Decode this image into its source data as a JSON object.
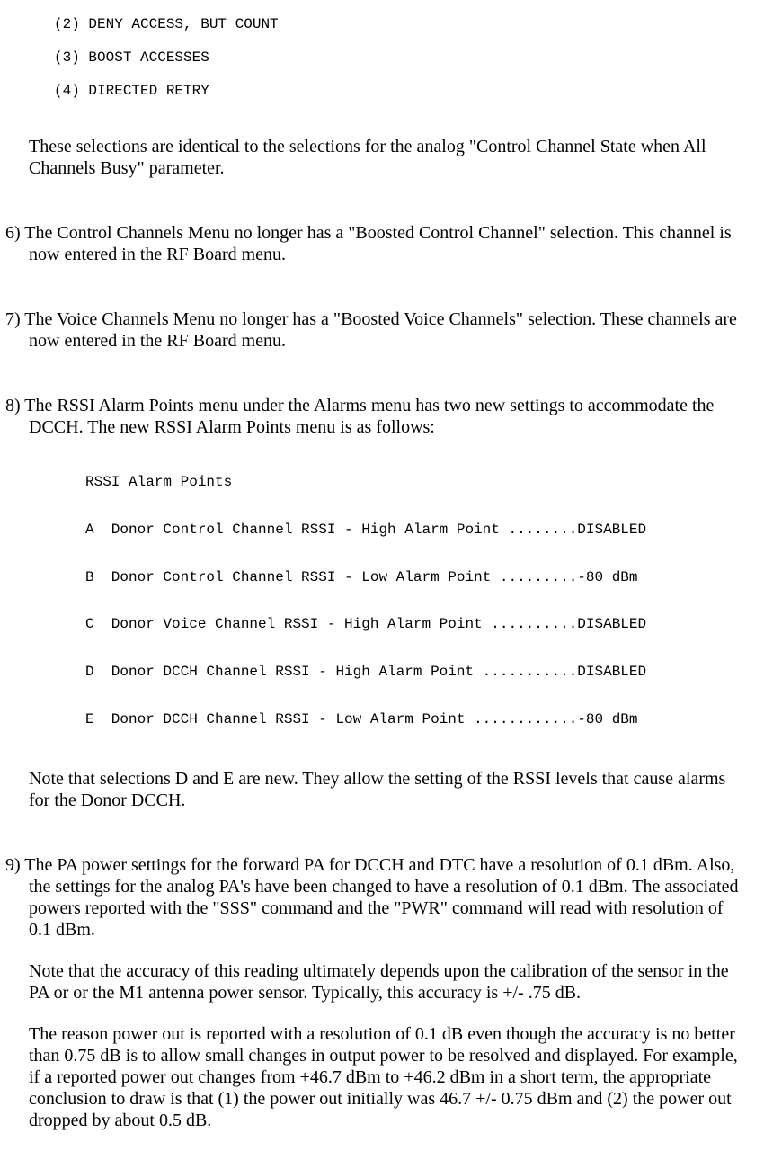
{
  "options": {
    "opt2": "(2) DENY ACCESS, BUT COUNT",
    "opt3": "(3) BOOST ACCESSES",
    "opt4": "(4) DIRECTED RETRY"
  },
  "para_after_options": "These selections are identical to the selections for the analog \"Control Channel State when All Channels Busy\" parameter.",
  "item6": "6) The Control Channels Menu no longer has a \"Boosted Control Channel\" selection. This channel is now entered in the RF Board menu.",
  "item7": "7) The Voice Channels Menu no longer has a \"Boosted Voice Channels\" selection. These channels are now entered in the RF Board menu.",
  "item8_intro": "8) The RSSI Alarm Points menu under the Alarms menu has two new settings to accommodate the DCCH. The new RSSI Alarm Points menu is as follows:",
  "rssi": {
    "title": "RSSI Alarm Points",
    "a": "A  Donor Control Channel RSSI - High Alarm Point ........DISABLED",
    "b": "B  Donor Control Channel RSSI - Low Alarm Point .........-80 dBm",
    "c": "C  Donor Voice Channel RSSI - High Alarm Point ..........DISABLED",
    "d": "D  Donor DCCH Channel RSSI - High Alarm Point ...........DISABLED",
    "e": "E  Donor DCCH Channel RSSI - Low Alarm Point ............-80 dBm"
  },
  "item8_note": "Note that selections D and E are new. They allow the setting of the RSSI levels that cause alarms for the Donor DCCH.",
  "item9_p1": "9) The PA power settings for the forward PA for DCCH and DTC have a resolution of 0.1 dBm. Also, the settings for the analog PA's have been changed to have a resolution of 0.1 dBm. The associated powers reported with the \"SSS\" command and the \"PWR\" command will read with resolution of 0.1 dBm.",
  "item9_p2": "Note that the accuracy of this reading ultimately depends upon the calibration of the sensor in the PA or or the M1 antenna power sensor.  Typically, this accuracy is +/- .75 dB.",
  "item9_p3": "The reason power out is reported with a resolution of 0.1 dB even though the accuracy is no better than 0.75 dB is to allow small changes in output power to be resolved and displayed. For example, if a reported power out changes from +46.7 dBm to +46.2 dBm in a short term, the appropriate conclusion to draw is that (1) the power out initially was 46.7 +/- 0.75 dBm and (2) the power out dropped by about 0.5 dB."
}
